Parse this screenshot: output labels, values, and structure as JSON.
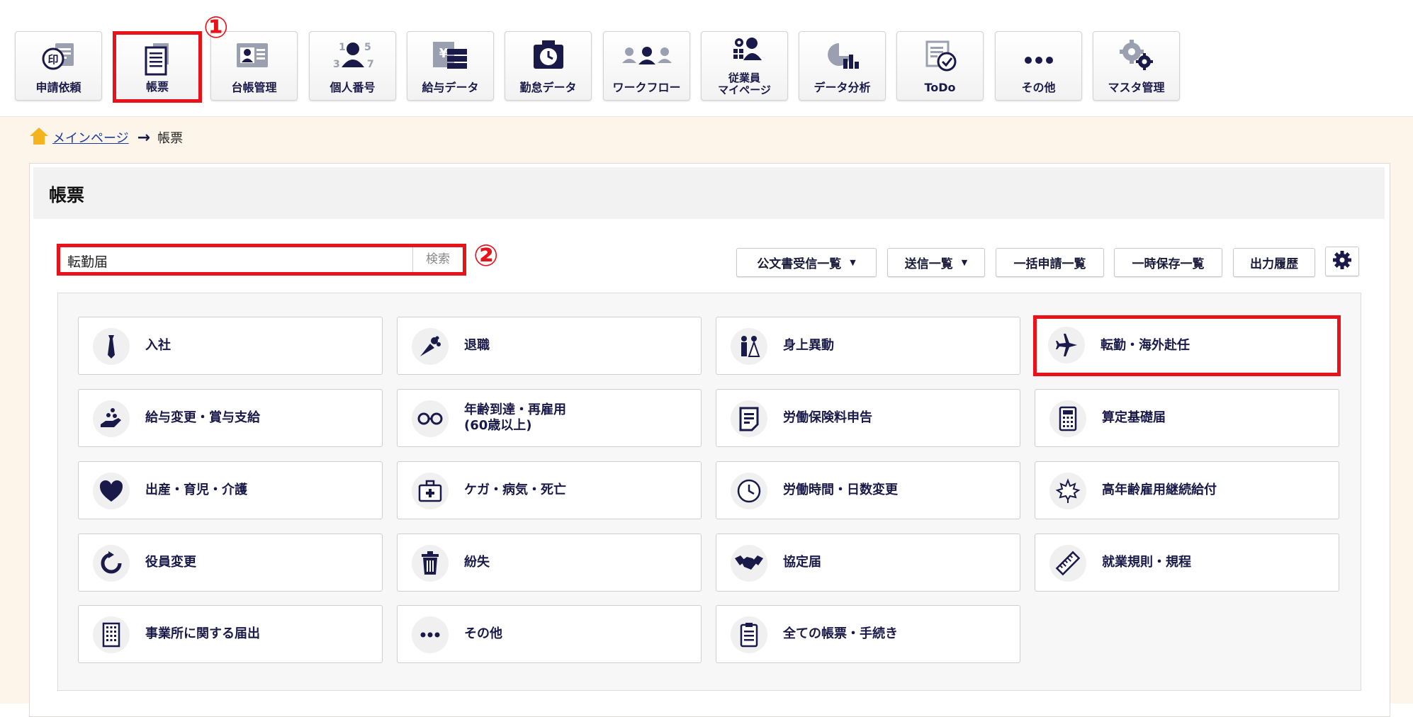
{
  "nav": {
    "items": [
      {
        "label": "申請依頼",
        "icon": "seal-request-icon"
      },
      {
        "label": "帳票",
        "icon": "forms-document-icon"
      },
      {
        "label": "台帳管理",
        "icon": "ledger-card-icon"
      },
      {
        "label": "個人番号",
        "icon": "personal-number-icon"
      },
      {
        "label": "給与データ",
        "icon": "payroll-data-icon"
      },
      {
        "label": "勤怠データ",
        "icon": "attendance-clock-icon"
      },
      {
        "label": "ワークフロー",
        "icon": "workflow-people-icon"
      },
      {
        "label": [
          "従業員",
          "マイページ"
        ],
        "icon": "employee-mypage-icon"
      },
      {
        "label": "データ分析",
        "icon": "data-analysis-chart-icon"
      },
      {
        "label": "ToDo",
        "icon": "todo-check-icon"
      },
      {
        "label": "その他",
        "icon": "more-dots-icon"
      },
      {
        "label": "マスタ管理",
        "icon": "master-gears-icon"
      }
    ]
  },
  "annotations": {
    "one": "①",
    "two": "②"
  },
  "breadcrumb": {
    "home": "メインページ",
    "current": "帳票"
  },
  "page": {
    "title": "帳票"
  },
  "search": {
    "value": "転勤届",
    "button": "検索"
  },
  "toolbar": {
    "public_docs": "公文書受信一覧",
    "sent_list": "送信一覧",
    "bulk_list": "一括申請一覧",
    "temp_saved": "一時保存一覧",
    "output_history": "出力履歴"
  },
  "tiles": [
    {
      "label": "入社",
      "icon": "necktie-icon"
    },
    {
      "label": "退職",
      "icon": "bouquet-icon"
    },
    {
      "label": "身上異動",
      "icon": "wedding-couple-icon"
    },
    {
      "label": "転勤・海外赴任",
      "icon": "airplane-icon"
    },
    {
      "label": "給与変更・賞与支給",
      "icon": "hand-coins-icon"
    },
    {
      "label": "年齢到達・再雇用\n(60歳以上)",
      "icon": "glasses-icon"
    },
    {
      "label": "労働保険料申告",
      "icon": "document-lines-icon"
    },
    {
      "label": "算定基礎届",
      "icon": "calculator-icon"
    },
    {
      "label": "出産・育児・介護",
      "icon": "heart-icon"
    },
    {
      "label": "ケガ・病気・死亡",
      "icon": "first-aid-kit-icon"
    },
    {
      "label": "労働時間・日数変更",
      "icon": "clock-icon"
    },
    {
      "label": "高年齢雇用継続給付",
      "icon": "maple-leaf-icon"
    },
    {
      "label": "役員変更",
      "icon": "refresh-icon"
    },
    {
      "label": "紛失",
      "icon": "trash-icon"
    },
    {
      "label": "協定届",
      "icon": "handshake-icon"
    },
    {
      "label": "就業規則・規程",
      "icon": "ruler-icon"
    },
    {
      "label": "事業所に関する届出",
      "icon": "building-icon"
    },
    {
      "label": "その他",
      "icon": "more-dots-icon"
    },
    {
      "label": "全ての帳票・手続き",
      "icon": "clipboard-list-icon"
    }
  ],
  "colors": {
    "accent_red": "#e8121b",
    "icon_navy": "#1a1a4a",
    "main_bg": "#fdf5e9"
  }
}
